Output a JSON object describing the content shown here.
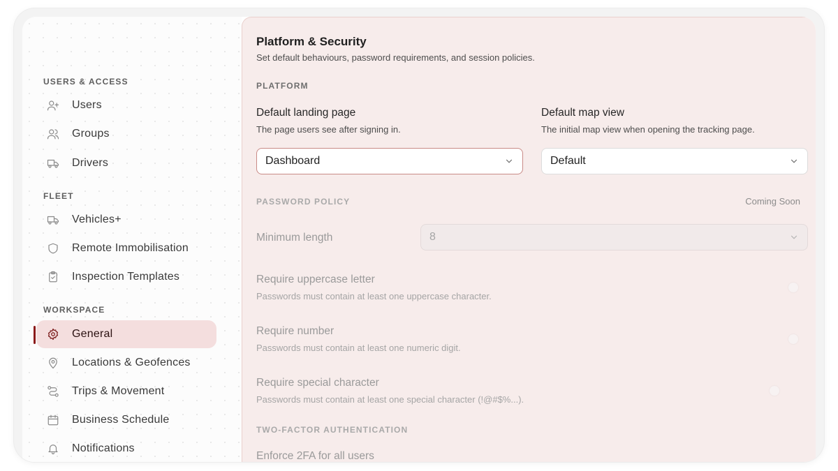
{
  "sidebar": {
    "sections": [
      {
        "label": "USERS & ACCESS",
        "items": [
          {
            "label": "Users",
            "icon": "user-plus-icon"
          },
          {
            "label": "Groups",
            "icon": "users-icon"
          },
          {
            "label": "Drivers",
            "icon": "truck-icon"
          }
        ]
      },
      {
        "label": "FLEET",
        "items": [
          {
            "label": "Vehicles+",
            "icon": "truck-icon"
          },
          {
            "label": "Remote Immobilisation",
            "icon": "shield-icon"
          },
          {
            "label": "Inspection Templates",
            "icon": "clipboard-check-icon"
          }
        ]
      },
      {
        "label": "WORKSPACE",
        "items": [
          {
            "label": "General",
            "icon": "gear-icon",
            "active": true
          },
          {
            "label": "Locations & Geofences",
            "icon": "map-pin-icon"
          },
          {
            "label": "Trips & Movement",
            "icon": "route-icon"
          },
          {
            "label": "Business Schedule",
            "icon": "calendar-icon"
          },
          {
            "label": "Notifications",
            "icon": "bell-icon"
          }
        ]
      }
    ]
  },
  "main": {
    "title": "Platform & Security",
    "subtitle": "Set default behaviours, password requirements, and session policies.",
    "platform": {
      "section_label": "PLATFORM",
      "landing": {
        "label": "Default landing page",
        "help": "The page users see after signing in.",
        "value": "Dashboard"
      },
      "map": {
        "label": "Default map view",
        "help": "The initial map view when opening the tracking page.",
        "value": "Default"
      }
    },
    "password": {
      "section_label": "PASSWORD POLICY",
      "badge": "Coming Soon",
      "min_length": {
        "label": "Minimum length",
        "value": "8"
      },
      "uppercase": {
        "label": "Require uppercase letter",
        "help": "Passwords must contain at least one uppercase character."
      },
      "number": {
        "label": "Require number",
        "help": "Passwords must contain at least one numeric digit."
      },
      "special": {
        "label": "Require special character",
        "help": "Passwords must contain at least one special character (!@#$%...)."
      }
    },
    "twofa": {
      "section_label": "TWO-FACTOR AUTHENTICATION",
      "enforce_label": "Enforce 2FA for all users"
    }
  },
  "colors": {
    "accent": "#8b1a1a",
    "active_bg": "#f4dede",
    "panel_bg": "#f7eceb"
  }
}
